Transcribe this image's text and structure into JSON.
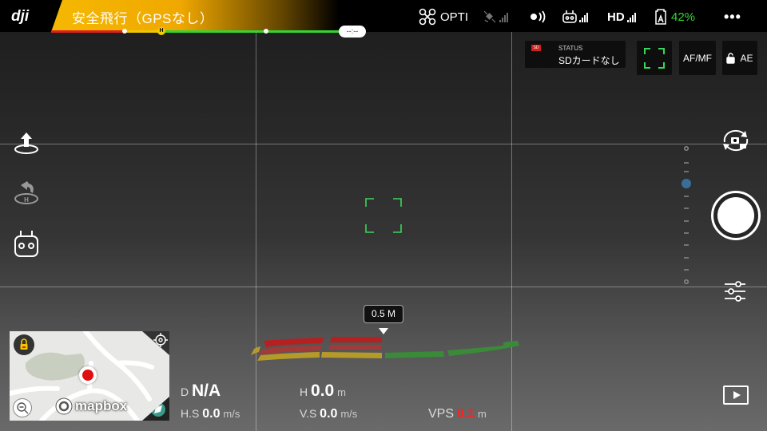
{
  "topbar": {
    "logo_text": "dji",
    "flight_status": "安全飛行（GPSなし）",
    "flight_time": "--:--",
    "home_marker": "H",
    "vision_mode": "OPTI",
    "video_link": "HD",
    "battery": "42%",
    "more": "•••"
  },
  "camera_status": {
    "label": "STATUS",
    "value": "SDカードなし",
    "sd_icon": "SD",
    "focus_mode": "AF/MF",
    "exposure_lock": "AE"
  },
  "obstacle": {
    "distance": "0.5 M"
  },
  "map": {
    "brand": "mapbox"
  },
  "telemetry": {
    "d_label": "D",
    "d_value": "N/A",
    "h_label": "H",
    "h_value": "0.0",
    "h_unit": "m",
    "hs_label": "H.S",
    "hs_value": "0.0",
    "hs_unit": "m/s",
    "vs_label": "V.S",
    "vs_value": "0.0",
    "vs_unit": "m/s",
    "vps_label": "VPS",
    "vps_value": "0.1",
    "vps_unit": "m"
  },
  "colors": {
    "status_warning": "#f5b800",
    "battery_green": "#33d633",
    "battery_text": "#33d633",
    "obstacle_red": "#c8202a",
    "obstacle_yellow": "#b59a2a",
    "obstacle_green": "#3a8a3a",
    "focus_green": "#3ad65a",
    "vps_red": "#ff2020"
  }
}
